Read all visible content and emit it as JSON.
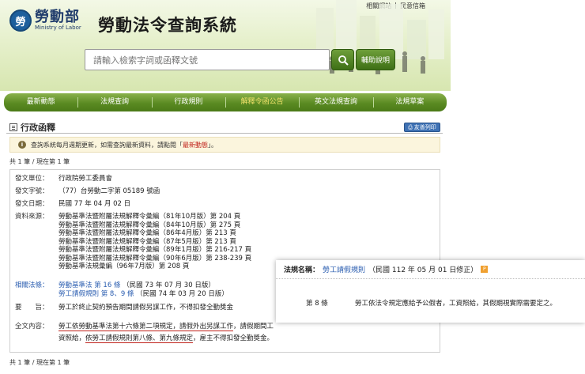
{
  "header": {
    "top_links": [
      "相關網站",
      "|",
      "民意信箱"
    ],
    "logo_zh": "勞動部",
    "logo_en": "Ministry of Labor",
    "logo_mark": "勞",
    "system_title": "勞動法令查詢系統",
    "search_placeholder": "請輸入檢索字詞或函釋文號",
    "help_label": "輔助說明"
  },
  "nav": {
    "items": [
      "最新動態",
      "法規查詢",
      "行政規則",
      "解釋令函公告",
      "英文法規查詢",
      "法規草案"
    ],
    "active_index": 3
  },
  "section": {
    "title": "行政函釋",
    "print_label": "友善列印"
  },
  "notice": {
    "text_before": "查詢系統每月週期更新，如需查詢最新資料，請點閱「",
    "link": "最新動態",
    "text_after": "」。"
  },
  "pager": {
    "top": "共 1 筆 / 現在第 1 筆",
    "bottom": "共 1 筆 / 現在第 1 筆"
  },
  "record": {
    "issuer_label": "發文單位：",
    "issuer": "行政院勞工委員會",
    "number_label": "發文字號：",
    "number": "（77）台勞動二字第 05189 號函",
    "date_label": "發文日期：",
    "date": "民國 77 年 04 月 02 日",
    "source_label": "資料來源：",
    "sources": [
      "勞動基準法暨附屬法規解釋令彙編（81年10月版）第 204 頁",
      "勞動基準法暨附屬法規解釋令彙編（84年10月版）第 275 頁",
      "勞動基準法暨附屬法規解釋令彙編（86年4月版）第 213 頁",
      "勞動基準法暨附屬法規解釋令彙編（87年5月版）第 213 頁",
      "勞動基準法暨附屬法規解釋令彙編（89年1月版）第 216-217 頁",
      "勞動基準法暨附屬法規解釋令彙編（90年6月版）第 238-239 頁",
      "勞動基準法規彙編（96年7月版）第 208 頁"
    ],
    "related_label": "相關法條：",
    "related": [
      {
        "law": "勞動基準法",
        "articles": "第 16 條",
        "date": "（民國 73 年 07 月 30 日版）"
      },
      {
        "law": "勞工請假規則",
        "articles": "第 8、9 條",
        "date": "（民國 74 年 03 月 20 日版）"
      }
    ],
    "summary_label": "要　　旨：",
    "summary": "勞工於終止契約預告期間請假另謀工作，不得扣發全勤獎金",
    "fulltext_label": "全文內容：",
    "fulltext_line1_a": "勞工依勞動基準法第十六條第二項規定，請假外出另謀工作",
    "fulltext_line1_b": "，請假期間工",
    "fulltext_line2_a": "資照給，",
    "fulltext_line2_b": "依勞工請假規則第八條、第九條規定",
    "fulltext_line2_c": "，雇主不得扣發全勤獎金。"
  },
  "popup": {
    "name_label": "法規名稱：",
    "law": "勞工請假規則",
    "date": "（民國 112 年 05 月 01 日修正）",
    "pdf_icon": "pdf-icon",
    "article_label": "第 8 條",
    "article_text": "勞工依法令規定應給予公假者，工資照給，其假期視實際需要定之。"
  },
  "colors": {
    "nav_green": "#5a8a22",
    "nav_active": "#f2e26b",
    "link_blue": "#2a5db0",
    "underline_red": "#c0221b"
  }
}
